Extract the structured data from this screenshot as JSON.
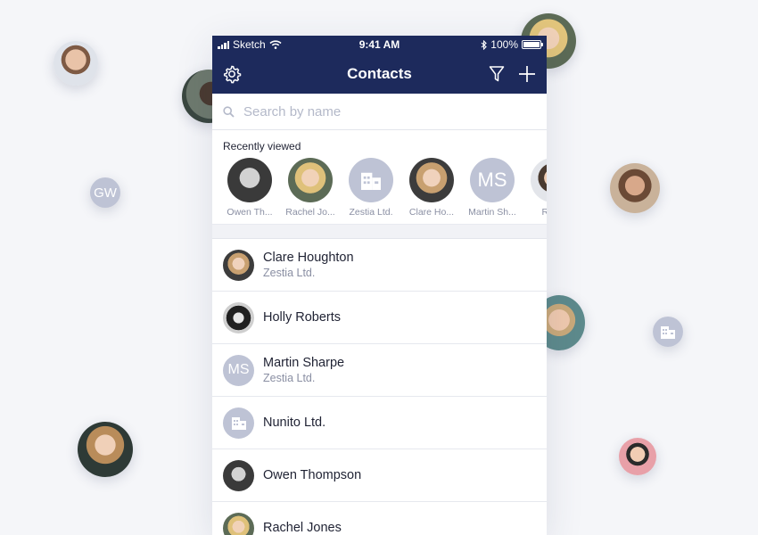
{
  "status_bar": {
    "carrier": "Sketch",
    "time": "9:41 AM",
    "battery": "100%"
  },
  "nav": {
    "title": "Contacts"
  },
  "search": {
    "placeholder": "Search by name"
  },
  "recent": {
    "title": "Recently viewed",
    "items": [
      {
        "name": "Owen Thompson",
        "label": "Owen Th...",
        "avatar": "photo"
      },
      {
        "name": "Rachel Jones",
        "label": "Rachel Jo...",
        "avatar": "photo"
      },
      {
        "name": "Zestia Ltd.",
        "label": "Zestia Ltd.",
        "avatar": "building"
      },
      {
        "name": "Clare Houghton",
        "label": "Clare Ho...",
        "avatar": "photo"
      },
      {
        "name": "Martin Sharpe",
        "label": "Martin Sh...",
        "avatar": "initials",
        "initials": "MS"
      },
      {
        "name": "Robert",
        "label": "Robe",
        "avatar": "photo"
      }
    ]
  },
  "contacts": [
    {
      "name": "Clare Houghton",
      "company": "Zestia Ltd.",
      "avatar": "photo"
    },
    {
      "name": "Holly Roberts",
      "company": "",
      "avatar": "photo"
    },
    {
      "name": "Martin Sharpe",
      "company": "Zestia Ltd.",
      "avatar": "initials",
      "initials": "MS"
    },
    {
      "name": "Nunito Ltd.",
      "company": "",
      "avatar": "building"
    },
    {
      "name": "Owen Thompson",
      "company": "",
      "avatar": "photo"
    },
    {
      "name": "Rachel Jones",
      "company": "",
      "avatar": "photo"
    }
  ],
  "background_avatars": {
    "initials_bubble": "GW"
  },
  "colors": {
    "header": "#1d2a5c",
    "background": "#f5f6f9",
    "avatar_placeholder": "#bec3d5",
    "primary_text": "#1f2233",
    "secondary_text": "#8a8fa3"
  }
}
